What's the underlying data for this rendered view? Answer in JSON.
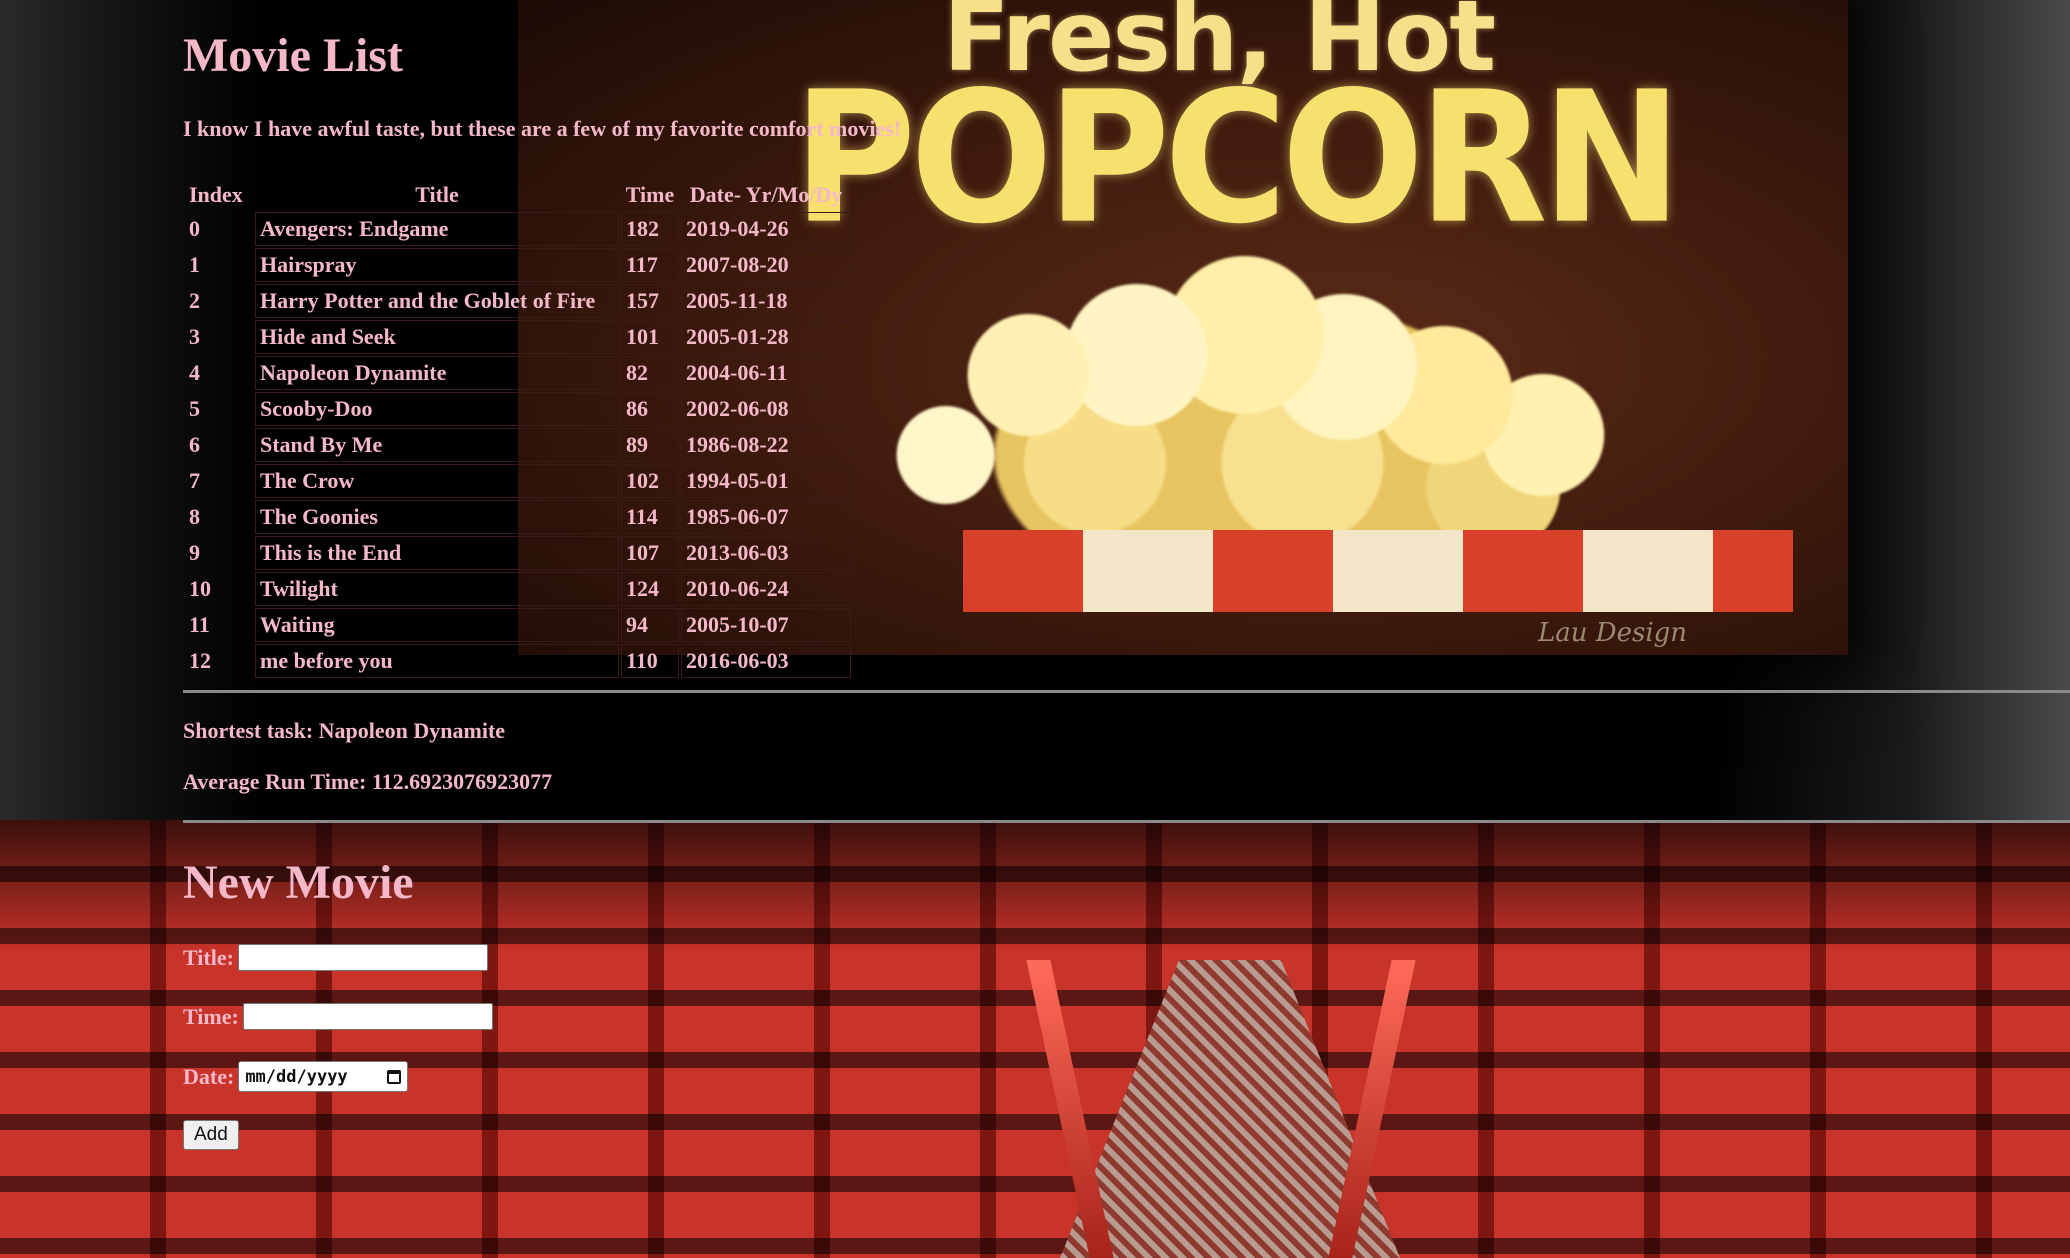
{
  "page": {
    "title": "Movie List",
    "intro": "I know I have awful taste, but these are a few of my favorite comfort movies!"
  },
  "background": {
    "screen_line_1": "Fresh, Hot",
    "screen_line_2": "POPCORN",
    "screen_signature": "Lau Design"
  },
  "table": {
    "headers": [
      "Index",
      "Title",
      "Time",
      "Date- Yr/Mo/Dy"
    ],
    "rows": [
      {
        "index": "0",
        "title": "Avengers: Endgame",
        "time": "182",
        "date": "2019-04-26"
      },
      {
        "index": "1",
        "title": "Hairspray",
        "time": "117",
        "date": "2007-08-20"
      },
      {
        "index": "2",
        "title": "Harry Potter and the Goblet of Fire",
        "time": "157",
        "date": "2005-11-18"
      },
      {
        "index": "3",
        "title": "Hide and Seek",
        "time": "101",
        "date": "2005-01-28"
      },
      {
        "index": "4",
        "title": "Napoleon Dynamite",
        "time": "82",
        "date": "2004-06-11"
      },
      {
        "index": "5",
        "title": "Scooby-Doo",
        "time": "86",
        "date": "2002-06-08"
      },
      {
        "index": "6",
        "title": "Stand By Me",
        "time": "89",
        "date": "1986-08-22"
      },
      {
        "index": "7",
        "title": "The Crow",
        "time": "102",
        "date": "1994-05-01"
      },
      {
        "index": "8",
        "title": "The Goonies",
        "time": "114",
        "date": "1985-06-07"
      },
      {
        "index": "9",
        "title": "This is the End",
        "time": "107",
        "date": "2013-06-03"
      },
      {
        "index": "10",
        "title": "Twilight",
        "time": "124",
        "date": "2010-06-24"
      },
      {
        "index": "11",
        "title": "Waiting",
        "time": "94",
        "date": "2005-10-07"
      },
      {
        "index": "12",
        "title": "me before you",
        "time": "110",
        "date": "2016-06-03"
      }
    ]
  },
  "stats": {
    "shortest": "Shortest task: Napoleon Dynamite",
    "average": "Average Run Time: 112.6923076923077"
  },
  "form": {
    "heading": "New Movie",
    "title_label": "Title:",
    "title_value": "",
    "time_label": "Time:",
    "time_value": "",
    "date_label": "Date:",
    "date_placeholder": "mm/dd/yyyy",
    "add_label": "Add"
  },
  "colors": {
    "text": "#f5b8c8",
    "divider": "#8a8a8a",
    "background": "#000000"
  }
}
